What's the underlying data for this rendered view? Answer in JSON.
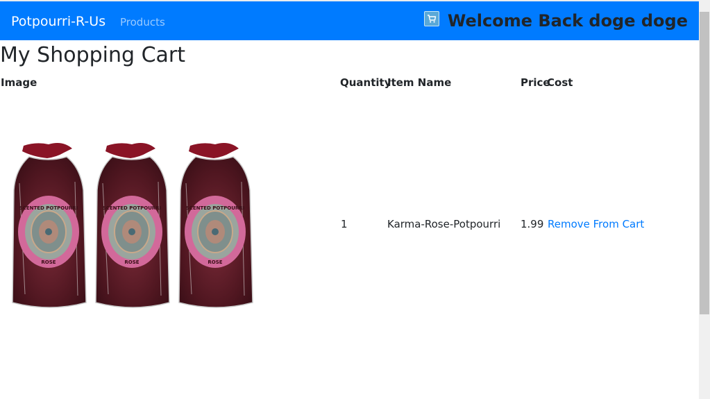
{
  "navbar": {
    "brand": "Potpourri-R-Us",
    "products_link": "Products",
    "cart_icon": "shopping-cart-icon",
    "welcome": "Welcome Back doge doge",
    "background_color": "#007bff"
  },
  "page": {
    "title": "My Shopping Cart"
  },
  "table": {
    "headers": {
      "image": "Image",
      "quantity": "Quantity",
      "item_name": "Item Name",
      "price": "Price",
      "cost": "Cost"
    },
    "rows": [
      {
        "image_alt": "Scented potpourri rose bags",
        "label_text": "SCENTED POTPOURRI",
        "label_variant": "ROSE",
        "quantity": "1",
        "item_name": "Karma-Rose-Potpourri",
        "price": "1.99",
        "action": "Remove From Cart"
      }
    ]
  },
  "colors": {
    "link": "#007bff",
    "bag_dark": "#5a1a26",
    "label_pink": "#d2699a"
  }
}
